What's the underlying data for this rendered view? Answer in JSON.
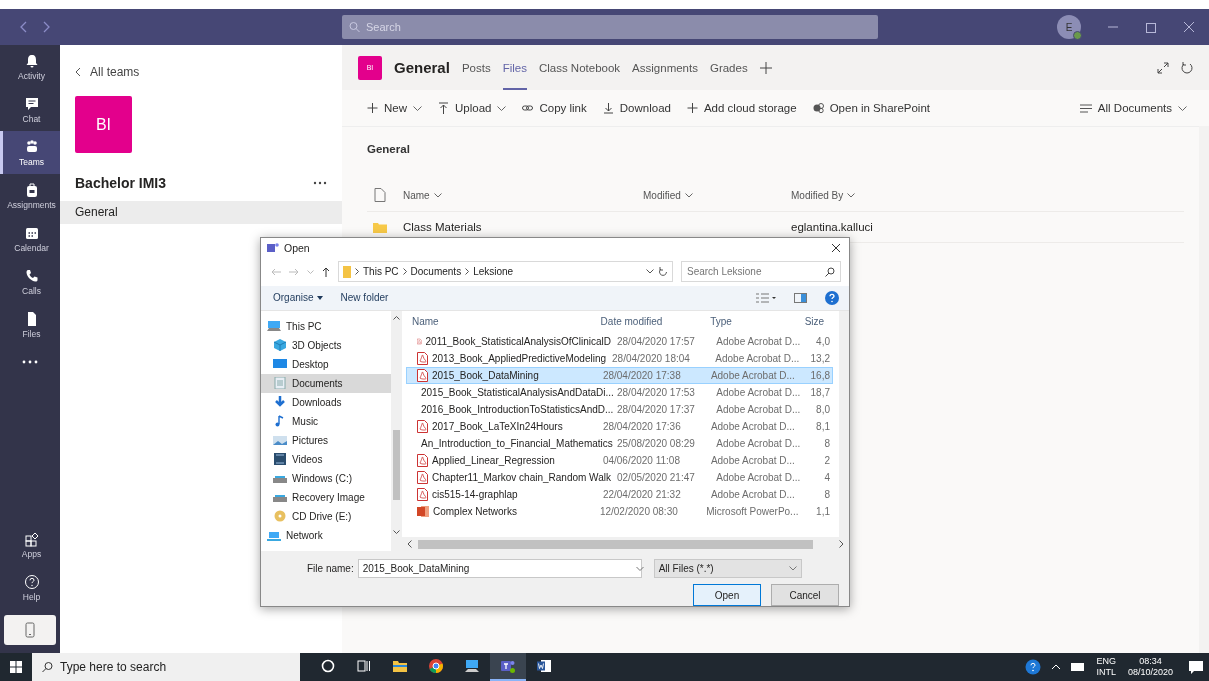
{
  "title_bar": {
    "search_placeholder": "Search",
    "avatar_initial": "E"
  },
  "rail": {
    "items": [
      {
        "label": "Activity",
        "kind": "bell",
        "selected": false
      },
      {
        "label": "Chat",
        "kind": "chat",
        "selected": false
      },
      {
        "label": "Teams",
        "kind": "teams",
        "selected": true
      },
      {
        "label": "Assignments",
        "kind": "bag",
        "selected": false
      },
      {
        "label": "Calendar",
        "kind": "calendar",
        "selected": false
      },
      {
        "label": "Calls",
        "kind": "phone",
        "selected": false
      },
      {
        "label": "Files",
        "kind": "file",
        "selected": false
      }
    ],
    "bottom_items": [
      {
        "label": "Apps",
        "kind": "apps"
      },
      {
        "label": "Help",
        "kind": "help"
      }
    ]
  },
  "team_panel": {
    "back_label": "All teams",
    "team_initials": "BI",
    "team_name": "Bachelor IMI3",
    "channels": [
      {
        "name": "General",
        "selected": true
      }
    ]
  },
  "channel": {
    "initials": "BI",
    "title": "General",
    "tabs": [
      {
        "label": "Posts",
        "selected": false
      },
      {
        "label": "Files",
        "selected": true
      },
      {
        "label": "Class Notebook",
        "selected": false
      },
      {
        "label": "Assignments",
        "selected": false
      },
      {
        "label": "Grades",
        "selected": false
      }
    ]
  },
  "toolbar": {
    "items": [
      {
        "label": "New",
        "kind": "plus",
        "dropdown": true
      },
      {
        "label": "Upload",
        "kind": "upload",
        "dropdown": true
      },
      {
        "label": "Copy link",
        "kind": "link",
        "dropdown": false
      },
      {
        "label": "Download",
        "kind": "download",
        "dropdown": false
      },
      {
        "label": "Add cloud storage",
        "kind": "plus",
        "dropdown": false
      },
      {
        "label": "Open in SharePoint",
        "kind": "sharepoint",
        "dropdown": false
      }
    ],
    "view": "All Documents"
  },
  "library": {
    "breadcrumb": "General",
    "columns": [
      "Name",
      "Modified",
      "Modified By"
    ],
    "rows": [
      {
        "name": "Class Materials",
        "modified_by": "eglantina.kalluci"
      }
    ]
  },
  "dialog": {
    "title": "Open",
    "path": [
      "This PC",
      "Documents",
      "Leksione"
    ],
    "search_placeholder": "Search Leksione",
    "commands": [
      "Organise",
      "New folder"
    ],
    "nav": [
      {
        "label": "This PC",
        "kind": "pc",
        "selected": false
      },
      {
        "label": "3D Objects",
        "kind": "cube",
        "selected": false
      },
      {
        "label": "Desktop",
        "kind": "desktop",
        "selected": false
      },
      {
        "label": "Documents",
        "kind": "docs",
        "selected": true
      },
      {
        "label": "Downloads",
        "kind": "download",
        "selected": false
      },
      {
        "label": "Music",
        "kind": "music",
        "selected": false
      },
      {
        "label": "Pictures",
        "kind": "pictures",
        "selected": false
      },
      {
        "label": "Videos",
        "kind": "videos",
        "selected": false
      },
      {
        "label": "Windows  (C:)",
        "kind": "drive",
        "selected": false
      },
      {
        "label": "Recovery Image",
        "kind": "drive",
        "selected": false
      },
      {
        "label": "CD Drive (E:)",
        "kind": "cd",
        "selected": false
      },
      {
        "label": "Network",
        "kind": "network",
        "selected": false
      }
    ],
    "columns": [
      "Name",
      "Date modified",
      "Type",
      "Size"
    ],
    "files": [
      {
        "name": "2011_Book_StatisticalAnalysisOfClinicalD",
        "date": "28/04/2020 17:57",
        "type": "Adobe Acrobat D...",
        "size": "4,0",
        "kind": "pdf",
        "selected": false
      },
      {
        "name": "2013_Book_AppliedPredictiveModeling",
        "date": "28/04/2020 18:04",
        "type": "Adobe Acrobat D...",
        "size": "13,2",
        "kind": "pdf",
        "selected": false
      },
      {
        "name": "2015_Book_DataMining",
        "date": "28/04/2020 17:38",
        "type": "Adobe Acrobat D...",
        "size": "16,8",
        "kind": "pdf",
        "selected": true
      },
      {
        "name": "2015_Book_StatisticalAnalysisAndDataDi...",
        "date": "28/04/2020 17:53",
        "type": "Adobe Acrobat D...",
        "size": "18,7",
        "kind": "pdf",
        "selected": false
      },
      {
        "name": "2016_Book_IntroductionToStatisticsAndD...",
        "date": "28/04/2020 17:37",
        "type": "Adobe Acrobat D...",
        "size": "8,0",
        "kind": "pdf",
        "selected": false
      },
      {
        "name": "2017_Book_LaTeXIn24Hours",
        "date": "28/04/2020 17:36",
        "type": "Adobe Acrobat D...",
        "size": "8,1",
        "kind": "pdf",
        "selected": false
      },
      {
        "name": "An_Introduction_to_Financial_Mathematics",
        "date": "25/08/2020 08:29",
        "type": "Adobe Acrobat D...",
        "size": "8",
        "kind": "pdf",
        "selected": false
      },
      {
        "name": "Applied_Linear_Regression",
        "date": "04/06/2020 11:08",
        "type": "Adobe Acrobat D...",
        "size": "2",
        "kind": "pdf",
        "selected": false
      },
      {
        "name": "Chapter11_Markov chain_Random Walk",
        "date": "02/05/2020 21:47",
        "type": "Adobe Acrobat D...",
        "size": "4",
        "kind": "pdf",
        "selected": false
      },
      {
        "name": "cis515-14-graphlap",
        "date": "22/04/2020 21:32",
        "type": "Adobe Acrobat D...",
        "size": "8",
        "kind": "pdf",
        "selected": false
      },
      {
        "name": "Complex Networks",
        "date": "12/02/2020 08:30",
        "type": "Microsoft PowerPo...",
        "size": "1,1",
        "kind": "ppt",
        "selected": false
      }
    ],
    "file_name_label": "File name:",
    "file_name": "2015_Book_DataMining",
    "filter": "All Files (*.*)",
    "buttons": [
      {
        "label": "Open",
        "default": true
      },
      {
        "label": "Cancel",
        "default": false
      }
    ]
  },
  "taskbar": {
    "search_placeholder": "Type here to search",
    "apps": [
      {
        "kind": "cortana",
        "active": false
      },
      {
        "kind": "taskview",
        "active": false
      },
      {
        "kind": "explorer",
        "active": false
      },
      {
        "kind": "chrome",
        "active": false
      },
      {
        "kind": "pc",
        "active": false
      },
      {
        "kind": "teams",
        "active": true
      },
      {
        "kind": "word",
        "active": false
      }
    ],
    "language": "ENG",
    "layout": "INTL",
    "time": "08:34",
    "date": "08/10/2020"
  }
}
